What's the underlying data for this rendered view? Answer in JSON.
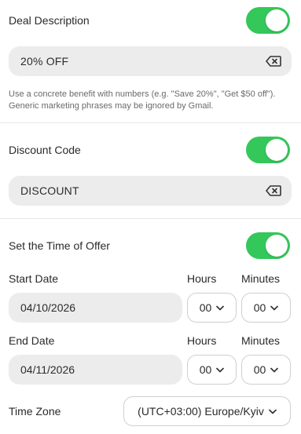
{
  "deal": {
    "label": "Deal Description",
    "enabled": true,
    "value": "20% OFF",
    "help": "Use a concrete benefit with numbers (e.g. \"Save 20%\", \"Get $50 off\"). Generic marketing phrases may be ignored by Gmail."
  },
  "discount": {
    "label": "Discount Code",
    "enabled": true,
    "value": "DISCOUNT"
  },
  "offer_time": {
    "label": "Set the Time of Offer",
    "enabled": true,
    "start": {
      "label": "Start Date",
      "date": "04/10/2026",
      "hours_label": "Hours",
      "minutes_label": "Minutes",
      "hours": "00",
      "minutes": "00"
    },
    "end": {
      "label": "End Date",
      "date": "04/11/2026",
      "hours_label": "Hours",
      "minutes_label": "Minutes",
      "hours": "00",
      "minutes": "00"
    },
    "timezone": {
      "label": "Time Zone",
      "value": "(UTC+03:00) Europe/Kyiv"
    }
  },
  "colors": {
    "toggle_on": "#34c759",
    "field_bg": "#ececec"
  },
  "icons": {
    "clear": "backspace-clear-icon",
    "chevron": "chevron-down-icon"
  }
}
